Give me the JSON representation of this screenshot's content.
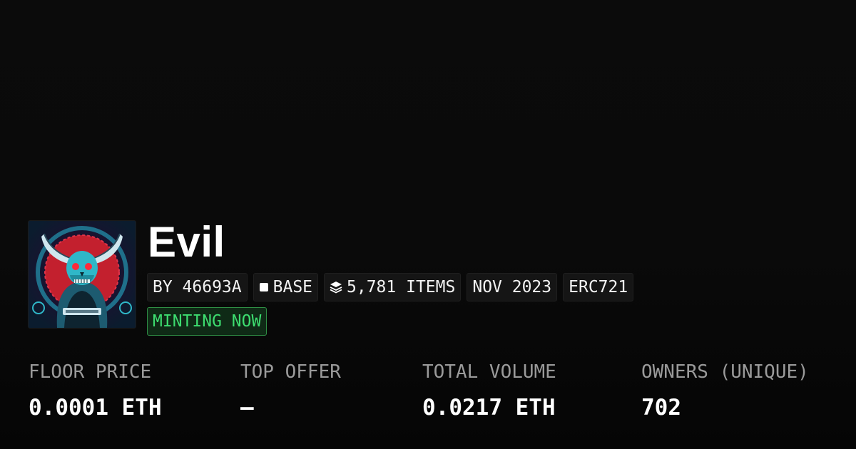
{
  "collection": {
    "title": "Evil",
    "thumbnail_alt": "Evil collection artwork",
    "creator_label": "BY 46693A",
    "chain": {
      "label": "BASE",
      "icon": "square-chain-icon"
    },
    "items": {
      "label": "5,781 ITEMS",
      "icon": "layers-icon"
    },
    "created": "NOV 2023",
    "standard": "ERC721",
    "status": "MINTING NOW"
  },
  "stats": [
    {
      "label": "FLOOR PRICE",
      "value": "0.0001 ETH"
    },
    {
      "label": "TOP OFFER",
      "value": "—"
    },
    {
      "label": "TOTAL VOLUME",
      "value": "0.0217 ETH"
    },
    {
      "label": "OWNERS (UNIQUE)",
      "value": "702"
    }
  ],
  "colors": {
    "background": "#0a0a0a",
    "pill_background": "#151515",
    "status_green": "#3ddc6f",
    "label_gray": "#9a9a9a"
  }
}
